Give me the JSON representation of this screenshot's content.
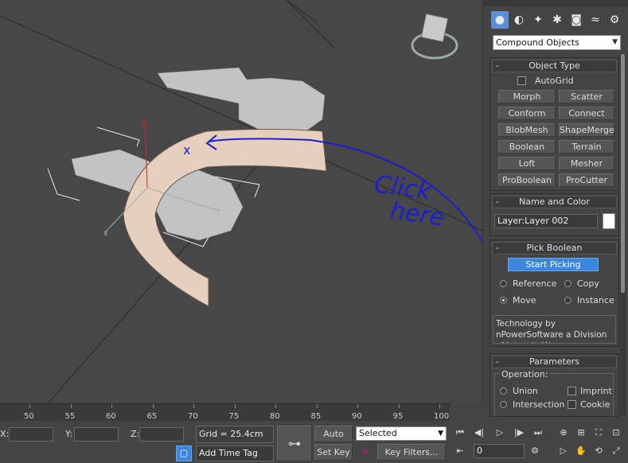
{
  "command_panel": {
    "category_dropdown": "Compound Objects",
    "object_type": {
      "title": "Object Type",
      "autogrid_label": "AutoGrid",
      "buttons": [
        "Morph",
        "Scatter",
        "Conform",
        "Connect",
        "BlobMesh",
        "ShapeMerge",
        "Boolean",
        "Terrain",
        "Loft",
        "Mesher",
        "ProBoolean",
        "ProCutter"
      ]
    },
    "name_and_color": {
      "title": "Name and Color",
      "name_value": "Layer:Layer 002",
      "color": "#ffffff"
    },
    "pick_boolean": {
      "title": "Pick Boolean",
      "start_picking": "Start Picking",
      "options": [
        "Reference",
        "Copy",
        "Move",
        "Instance"
      ],
      "selected_option": "Move",
      "info_text": "Technology by nPowerSoftware a Division of IntegrityWare,"
    },
    "parameters": {
      "title": "Parameters",
      "operation_label": "Operation:",
      "operations": [
        "Union",
        "Intersection"
      ],
      "checkboxes": [
        "Imprint",
        "Cookie"
      ]
    }
  },
  "annotation": {
    "text_line1": "Click",
    "text_line2": "here",
    "cursor_mark": "x"
  },
  "timeline": {
    "ticks": [
      "50",
      "55",
      "60",
      "65",
      "70",
      "75",
      "80",
      "85",
      "90",
      "95",
      "100"
    ]
  },
  "statusbar": {
    "x_label": "X:",
    "y_label": "Y:",
    "z_label": "Z:",
    "grid": "Grid = 25.4cm",
    "add_time_tag": "Add Time Tag",
    "auto_key": "Auto Key",
    "set_key": "Set Key",
    "key_dropdown": "Selected",
    "key_filters": "Key Filters...",
    "frame_value": "0"
  },
  "colors": {
    "accent_blue": "#3c86dd",
    "annotation_blue": "#1a1fd1"
  }
}
